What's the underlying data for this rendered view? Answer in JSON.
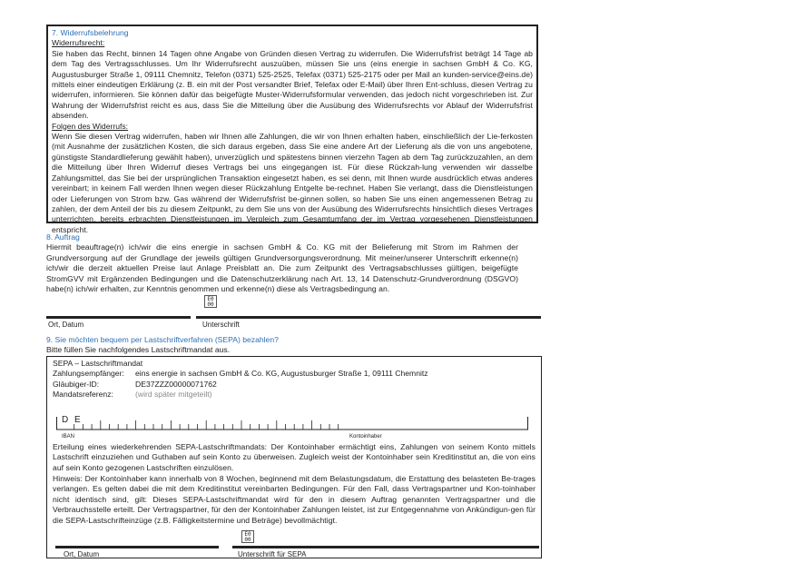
{
  "section7": {
    "title": "7. Widerrufsbelehrung",
    "sub1": "Widerrufsrecht:",
    "text1": "Sie haben das Recht, binnen 14 Tagen ohne Angabe von Gründen diesen Vertrag zu widerrufen. Die Widerrufsfrist beträgt 14 Tage ab dem Tag des Vertragsschlusses. Um Ihr Widerrufsrecht auszuüben, müssen Sie uns (eins energie in sachsen GmbH & Co. KG, Augustusburger Straße 1, 09111 Chemnitz, Telefon (0371) 525-2525, Telefax (0371) 525-2175 oder per Mail an kunden-service@eins.de) mittels einer eindeutigen Erklärung (z. B. ein mit der Post versandter Brief, Telefax oder E-Mail) über Ihren Ent-schluss, diesen Vertrag zu widerrufen, informieren. Sie können dafür das beigefügte Muster-Widerrufsformular verwenden, das jedoch nicht vorgeschrieben ist. Zur Wahrung der Widerrufsfrist reicht es aus, dass Sie die Mitteilung über die Ausübung des Widerrufsrechts vor Ablauf der Widerrufsfrist absenden.",
    "sub2": "Folgen des Widerrufs:",
    "text2": "Wenn Sie diesen Vertrag widerrufen, haben wir Ihnen alle Zahlungen, die wir von Ihnen erhalten haben, einschließlich der Lie-ferkosten (mit Ausnahme der zusätzlichen Kosten, die sich daraus ergeben, dass Sie eine andere Art der Lieferung als die von uns angebotene, günstigste Standardlieferung gewählt haben), unverzüglich und spätestens binnen vierzehn Tagen ab dem Tag zurückzuzahlen, an dem die Mitteilung über Ihren Widerruf dieses Vertrags bei uns eingegangen ist. Für diese Rückzah-lung verwenden wir dasselbe Zahlungsmittel, das Sie bei der ursprünglichen Transaktion eingesetzt haben, es sei denn, mit Ihnen wurde ausdrücklich etwas anderes vereinbart; in keinem Fall werden Ihnen wegen dieser Rückzahlung Entgelte be-rechnet. Haben Sie verlangt, dass die Dienstleistungen oder Lieferungen von Strom bzw. Gas während der Widerrufsfrist be-ginnen sollen, so haben Sie uns einen angemessenen Betrag zu zahlen, der dem Anteil der bis zu diesem Zeitpunkt, zu dem Sie uns von der Ausübung des Widerrufsrechts hinsichtlich dieses Vertrages unterrichten, bereits erbrachten Dienstleistungen im Vergleich zum Gesamtumfang der im Vertrag vorgesehenen Dienstleistungen entspricht."
  },
  "section8": {
    "title": "8. Auftrag",
    "text": "Hiermit beauftrage(n) ich/wir die eins energie in sachsen GmbH & Co. KG mit der Belieferung mit Strom im Rahmen der Grundversorgung auf der Grundlage der jeweils gültigen Grundversorgungsverordnung. Mit meiner/unserer Unterschrift erkenne(n) ich/wir die derzeit aktuellen Preise laut Anlage Preisblatt an. Die zum Zeitpunkt des Vertragsabschlusses gültigen, beigefügte StromGVV mit Ergänzenden Bedingungen und die Datenschutzerklärung nach Art. 13, 14 Datenschutz-Grundverordnung (DSGVO) habe(n) ich/wir erhalten, zur Kenntnis genommen und erkenne(n) diese als Vertragsbedingung an.",
    "label_place_date": "Ort, Datum",
    "label_signature": "Unterschrift"
  },
  "section9": {
    "title": "9. Sie möchten bequem per Lastschriftverfahren (SEPA) bezahlen?",
    "intro": "Bitte füllen Sie nachfolgendes Lastschriftmandat aus.",
    "mandate_title": "SEPA – Lastschriftmandat",
    "payee_label": "Zahlungsempfänger:",
    "payee_value": "eins energie in sachsen GmbH & Co. KG, Augustusburger Straße 1, 09111 Chemnitz",
    "creditor_label": "Gläubiger-ID:",
    "creditor_value": "DE37ZZZ00000071762",
    "mandate_ref_label": "Mandatsreferenz:",
    "mandate_ref_value": "(wird später mitgeteilt)",
    "iban_prefix": "D E",
    "iban_label": "IBAN",
    "account_holder_label": "Kontoinhaber",
    "recurring_text": "Erteilung eines wiederkehrenden SEPA-Lastschriftmandats: Der Kontoinhaber ermächtigt eins, Zahlungen von seinem Konto mittels Lastschrift einzuziehen und Guthaben auf sein Konto zu überweisen. Zugleich weist der Kontoinhaber sein Kreditinstitut an, die von eins auf sein Konto gezogenen Lastschriften einzulösen.",
    "hint_text": "Hinweis: Der Kontoinhaber kann innerhalb von 8 Wochen, beginnend mit dem Belastungsdatum, die Erstattung des belasteten Be-trages verlangen. Es gelten dabei die mit dem Kreditinstitut vereinbarten Bedingungen. Für den Fall, dass Vertragspartner und Kon-toinhaber nicht identisch sind, gilt: Dieses SEPA-Lastschriftmandat wird für den in diesem Auftrag genannten Vertragspartner und die Verbrauchsstelle erteilt. Der Vertragspartner, für den der Kontoinhaber Zahlungen leistet, ist zur Entgegennahme von Ankündigun-gen für die SEPA-Lastschrifteinzüge (z.B. Fälligkeitstermine und Beträge) bevollmächtigt.",
    "label_place_date": "Ort, Datum",
    "label_signature": "Unterschrift für SEPA"
  },
  "qr_glyph": "E0\n00",
  "colors": {
    "accent": "#2d6fb6",
    "text": "#222222"
  }
}
